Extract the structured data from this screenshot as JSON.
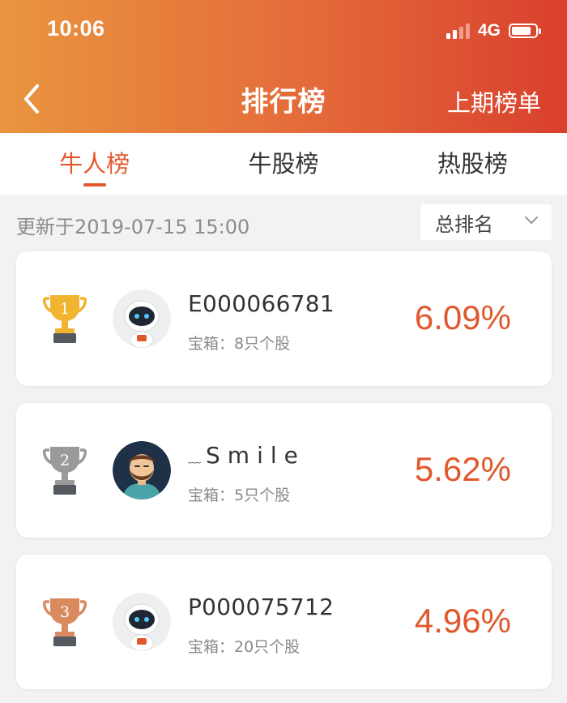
{
  "status_bar": {
    "time": "10:06",
    "network": "4G"
  },
  "nav": {
    "title": "排行榜",
    "right_link": "上期榜单"
  },
  "tabs": [
    {
      "label": "牛人榜",
      "active": true
    },
    {
      "label": "牛股榜",
      "active": false
    },
    {
      "label": "热股榜",
      "active": false
    }
  ],
  "update_text": "更新于2019-07-15 15:00",
  "rank_filter": {
    "selected": "总排名"
  },
  "ranking": [
    {
      "rank": "1",
      "medal": "gold",
      "avatar": "robot-avatar",
      "name": "E000066781",
      "chest": "宝箱：8只个股",
      "return_pct": "6.09%"
    },
    {
      "rank": "2",
      "medal": "silver",
      "avatar": "bearded-man-avatar",
      "name_prefix": "﹏",
      "name": "Smile",
      "chest": "宝箱：5只个股",
      "return_pct": "5.62%"
    },
    {
      "rank": "3",
      "medal": "bronze",
      "avatar": "robot-avatar",
      "name": "P000075712",
      "chest": "宝箱：20只个股",
      "return_pct": "4.96%"
    }
  ],
  "colors": {
    "header_gradient_start": "#e9953f",
    "header_gradient_end": "#d9402d",
    "accent": "#e2582d",
    "gold": "#f0b431",
    "silver": "#9a9a9a",
    "bronze": "#d98a5e"
  }
}
